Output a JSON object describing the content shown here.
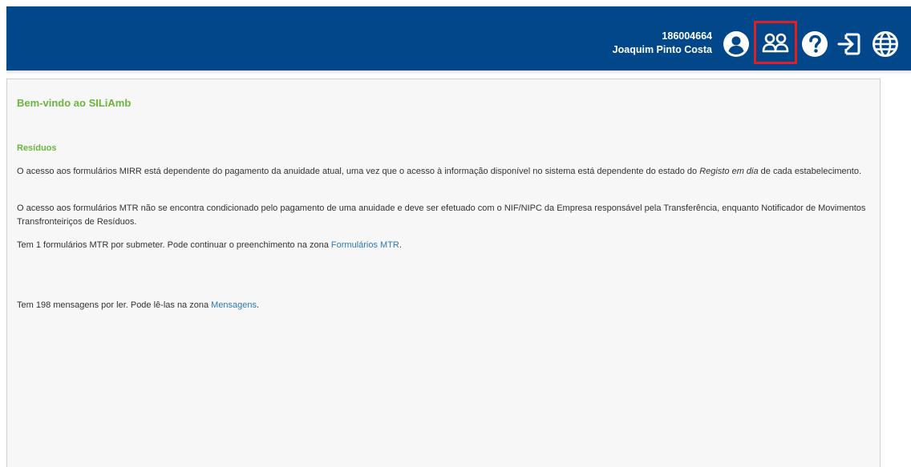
{
  "header": {
    "user_id": "186004664",
    "user_name": "Joaquim Pinto Costa",
    "icons": [
      "account-icon",
      "group-icon",
      "help-icon",
      "logout-icon",
      "language-globe-icon"
    ],
    "colors": {
      "bar": "#02478a",
      "highlight": "#e02020"
    }
  },
  "main": {
    "welcome": "Bem-vindo ao SILiAmb",
    "section_title": "Resíduos",
    "p1_a": "O acesso aos formulários MIRR está dependente do pagamento da anuidade atual, uma vez que o acesso à informação disponível no sistema está dependente do estado do ",
    "p1_em": "Registo em dia",
    "p1_b": " de cada estabelecimento.",
    "p2": "O acesso aos formulários MTR não se encontra condicionado pelo pagamento de uma anuidade e deve ser efetuado com o NIF/NIPC da Empresa responsável pela Transferência, enquanto Notificador de Movimentos Transfronteiriços de Resíduos.",
    "p3_a": "Tem 1 formulários MTR por submeter. Pode continuar o preenchimento na zona ",
    "p3_link": "Formulários MTR",
    "p3_b": ".",
    "p4_a": "Tem 198 mensagens por ler. Pode lê-las na zona ",
    "p4_link": "Mensagens",
    "p4_b": ".",
    "colors": {
      "heading": "#6db33f",
      "link": "#2a7ab8"
    }
  }
}
